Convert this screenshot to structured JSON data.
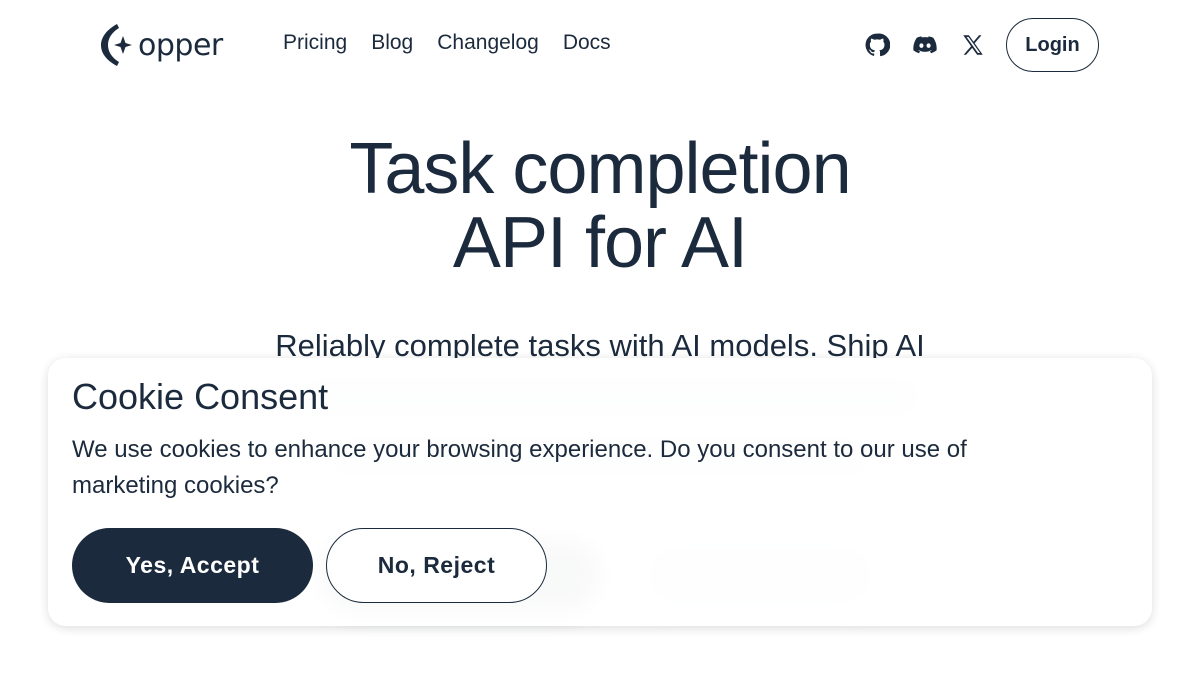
{
  "brand": {
    "logo_icon": "opper-logo-icon",
    "name": "opper",
    "primary_color": "#1b2a3c"
  },
  "nav": {
    "items": [
      {
        "label": "Pricing"
      },
      {
        "label": "Blog"
      },
      {
        "label": "Changelog"
      },
      {
        "label": "Docs"
      }
    ]
  },
  "social": {
    "icons": [
      "github-icon",
      "discord-icon",
      "x-icon"
    ]
  },
  "header": {
    "login_label": "Login"
  },
  "hero": {
    "title_line1": "Task completion",
    "title_line2": "API for AI",
    "subtitle": "Reliably complete tasks with AI models. Ship AI"
  },
  "cookie": {
    "title": "Cookie Consent",
    "text": "We use cookies to enhance your browsing experience. Do you consent to our use of marketing cookies?",
    "accept_label": "Yes, Accept",
    "reject_label": "No, Reject"
  }
}
